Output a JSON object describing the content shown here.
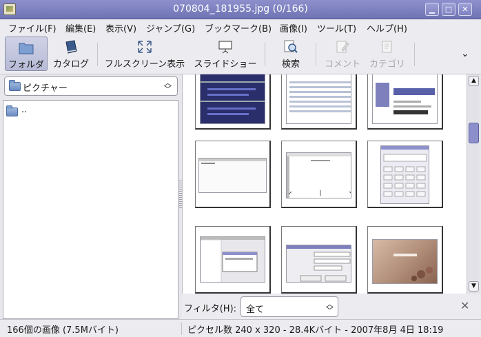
{
  "window": {
    "title": "070804_181955.jpg  (0/166)"
  },
  "menu": [
    "ファイル(F)",
    "編集(E)",
    "表示(V)",
    "ジャンプ(G)",
    "ブックマーク(B)",
    "画像(I)",
    "ツール(T)",
    "ヘルプ(H)"
  ],
  "toolbar": {
    "folder": "フォルダ",
    "catalog": "カタログ",
    "fullscreen": "フルスクリーン表示",
    "slideshow": "スライドショー",
    "search": "検索",
    "comment": "コメント",
    "category": "カテゴリ"
  },
  "sidebar": {
    "location": "ピクチャー",
    "items": [
      {
        "label": ".."
      }
    ]
  },
  "filter": {
    "label": "フィルタ(H):",
    "value": "全て"
  },
  "status": {
    "left": "166個の画像 (7.5Mバイト)",
    "right": "ピクセル数 240 x 320 - 28.4Kバイト - 2007年8月 4日 18:19"
  },
  "thumbnails": [
    {
      "name": "screenshot-dark-blue"
    },
    {
      "name": "screenshot-file-list"
    },
    {
      "name": "screenshot-vine-linux"
    },
    {
      "name": "screenshot-empty-window"
    },
    {
      "name": "screenshot-drawing-window"
    },
    {
      "name": "screenshot-calculator"
    },
    {
      "name": "screenshot-file-manager"
    },
    {
      "name": "screenshot-dialog"
    },
    {
      "name": "screenshot-login"
    }
  ]
}
